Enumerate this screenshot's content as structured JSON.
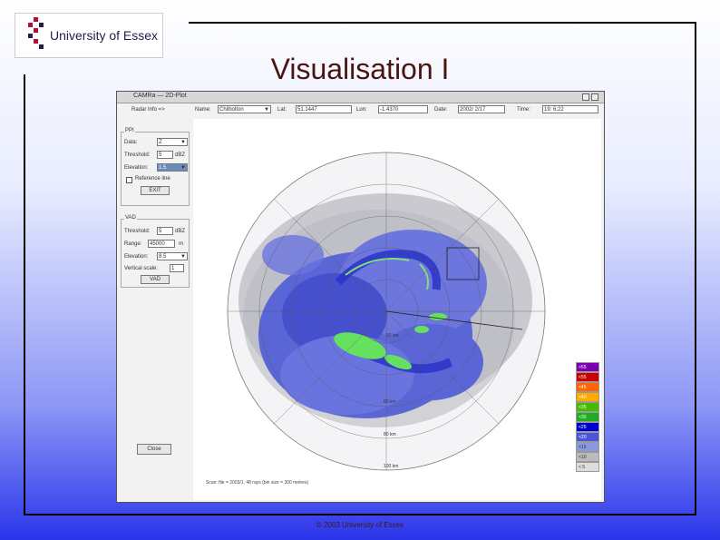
{
  "logo": {
    "text": "University of Essex"
  },
  "slide": {
    "title": "Visualisation I",
    "footer": "© 2003 University of Essex"
  },
  "window": {
    "title": "CAMRa — 2D-Plot"
  },
  "topbar": {
    "radar_info": "Radar Info =>",
    "name_label": "Name:",
    "name_value": "Chilbolton",
    "lat_label": "Lat:",
    "lat_value": "51.1447",
    "lon_label": "Lon:",
    "lon_value": "-1.4370",
    "date_label": "Date:",
    "date_value": "2002/ 2/17",
    "time_label": "Time:",
    "time_value": "19: 6:22"
  },
  "ppi": {
    "group_label": "PPI",
    "data_label": "Data:",
    "data_value": "Z",
    "threshold_label": "Threshold:",
    "threshold_value": "5",
    "threshold_unit": "dBZ",
    "elevation_label": "Elevation:",
    "elevation_value": "1.5",
    "reference_label": "Reference line",
    "button": "EXIT"
  },
  "vad": {
    "group_label": "VAD",
    "threshold_label": "Threshold:",
    "threshold_value": "5",
    "threshold_unit": "dBZ",
    "range_label": "Range:",
    "range_value": "45000",
    "range_unit": "m",
    "elevation_label": "Elevation:",
    "elevation_value": "8.5",
    "vertical_scale_label": "Vertical scale:",
    "vertical_scale_value": "1",
    "button": "VAD"
  },
  "close_button": "Close",
  "range_rings": [
    "50 km",
    "60 km",
    "80 km",
    "100 km"
  ],
  "legend": [
    {
      "label": ">55",
      "color": "#7a00b0"
    },
    {
      "label": "<55",
      "color": "#cc0000"
    },
    {
      "label": "<45",
      "color": "#ff6600"
    },
    {
      "label": "<40",
      "color": "#ffaa00"
    },
    {
      "label": "<35",
      "color": "#44bb00"
    },
    {
      "label": "<30",
      "color": "#22aa22"
    },
    {
      "label": "<25",
      "color": "#0000cc"
    },
    {
      "label": "<20",
      "color": "#4a55d8"
    },
    {
      "label": "<15",
      "color": "#8899dd"
    },
    {
      "label": "<10",
      "color": "#bbbbbb"
    },
    {
      "label": "< 5",
      "color": "#dddddd"
    }
  ],
  "status": "Scan: file = 2003/1, 48 rays (bin size = 300 metres)"
}
